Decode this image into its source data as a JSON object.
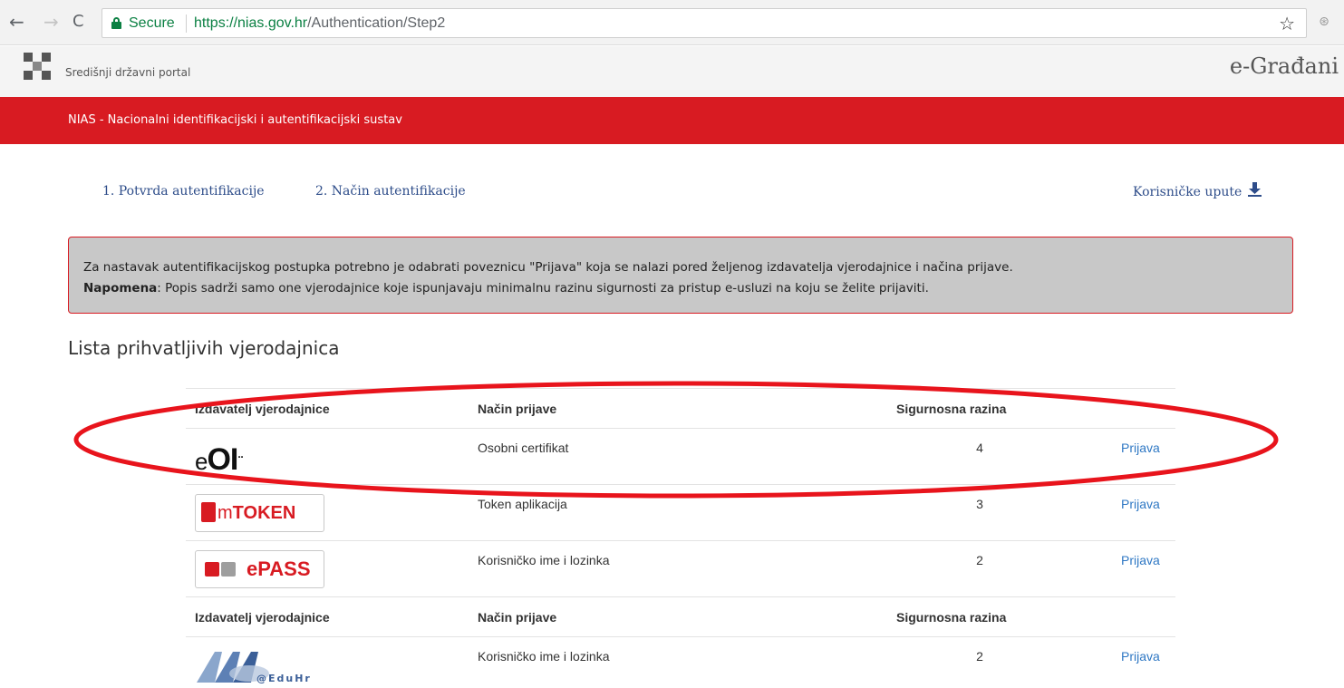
{
  "browser": {
    "secure_label": "Secure",
    "url_scheme": "https://",
    "url_host": "nias.gov.hr",
    "url_path": "/Authentication/Step2"
  },
  "portal": {
    "title": "Središnji državni portal",
    "brand": "e-Građani"
  },
  "band": {
    "title": "NIAS - Nacionalni identifikacijski i autentifikacijski sustav"
  },
  "steps": {
    "step1": "1. Potvrda autentifikacije",
    "step2": "2. Način autentifikacije",
    "user_guide": "Korisničke upute"
  },
  "notice": {
    "line1": "Za nastavak autentifikacijskog postupka potrebno je odabrati poveznicu \"Prijava\" koja se nalazi pored željenog izdavatelja vjerodajnice i načina prijave.",
    "note_label": "Napomena",
    "line2": ": Popis sadrži samo one vjerodajnice koje ispunjavaju minimalnu razinu sigurnosti za pristup e-usluzi na koju se želite prijaviti."
  },
  "list_title": "Lista prihvatljivih vjerodajnica",
  "table": {
    "headers": {
      "issuer": "Izdavatelj vjerodajnice",
      "method": "Način prijave",
      "level": "Sigurnosna razina"
    },
    "group1": [
      {
        "logo": "eOI",
        "method": "Osobni certifikat",
        "level": "4",
        "action": "Prijava"
      },
      {
        "logo": "mTOKEN",
        "method": "Token aplikacija",
        "level": "3",
        "action": "Prijava"
      },
      {
        "logo": "ePASS",
        "method": "Korisničko ime i lozinka",
        "level": "2",
        "action": "Prijava"
      }
    ],
    "group2": [
      {
        "logo": "AAI@EduHr",
        "method": "Korisničko ime i lozinka",
        "level": "2",
        "action": "Prijava"
      }
    ]
  },
  "logos": {
    "eoi_e": "e",
    "eoi_o": "OI",
    "mtoken_m": "m",
    "mtoken_token": "TOKEN",
    "epass": "ePASS",
    "aai_edu": "@EduHr"
  },
  "colors": {
    "accent_red": "#d81b22",
    "link_blue": "#2f78c4",
    "step_blue": "#2e4d8a",
    "secure_green": "#0b8043"
  }
}
